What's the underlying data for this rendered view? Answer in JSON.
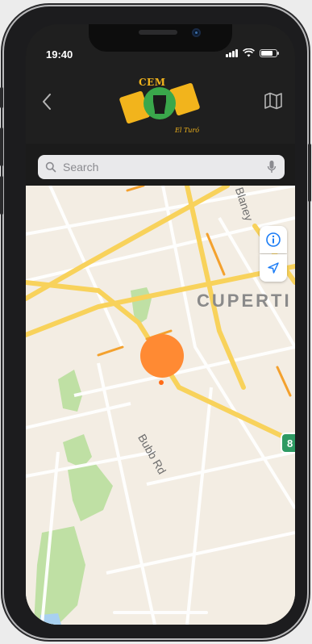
{
  "status_bar": {
    "time": "19:40"
  },
  "header": {
    "logo_top_text": "CEM",
    "logo_bottom_text": "El Turó"
  },
  "search": {
    "placeholder": "Search"
  },
  "map": {
    "city_label": "CUPERTI",
    "road_bubb": "Bubb Rd",
    "road_blaney": "Blaney",
    "highway_shield": "8",
    "pin_color": "#ff8a33"
  },
  "colors": {
    "navbar_bg": "#1f1f1f",
    "road_major": "#f8d25b",
    "road_orange": "#f3a12e",
    "park_green": "#bfe0a4",
    "accent_logo": "#f2b41c"
  }
}
